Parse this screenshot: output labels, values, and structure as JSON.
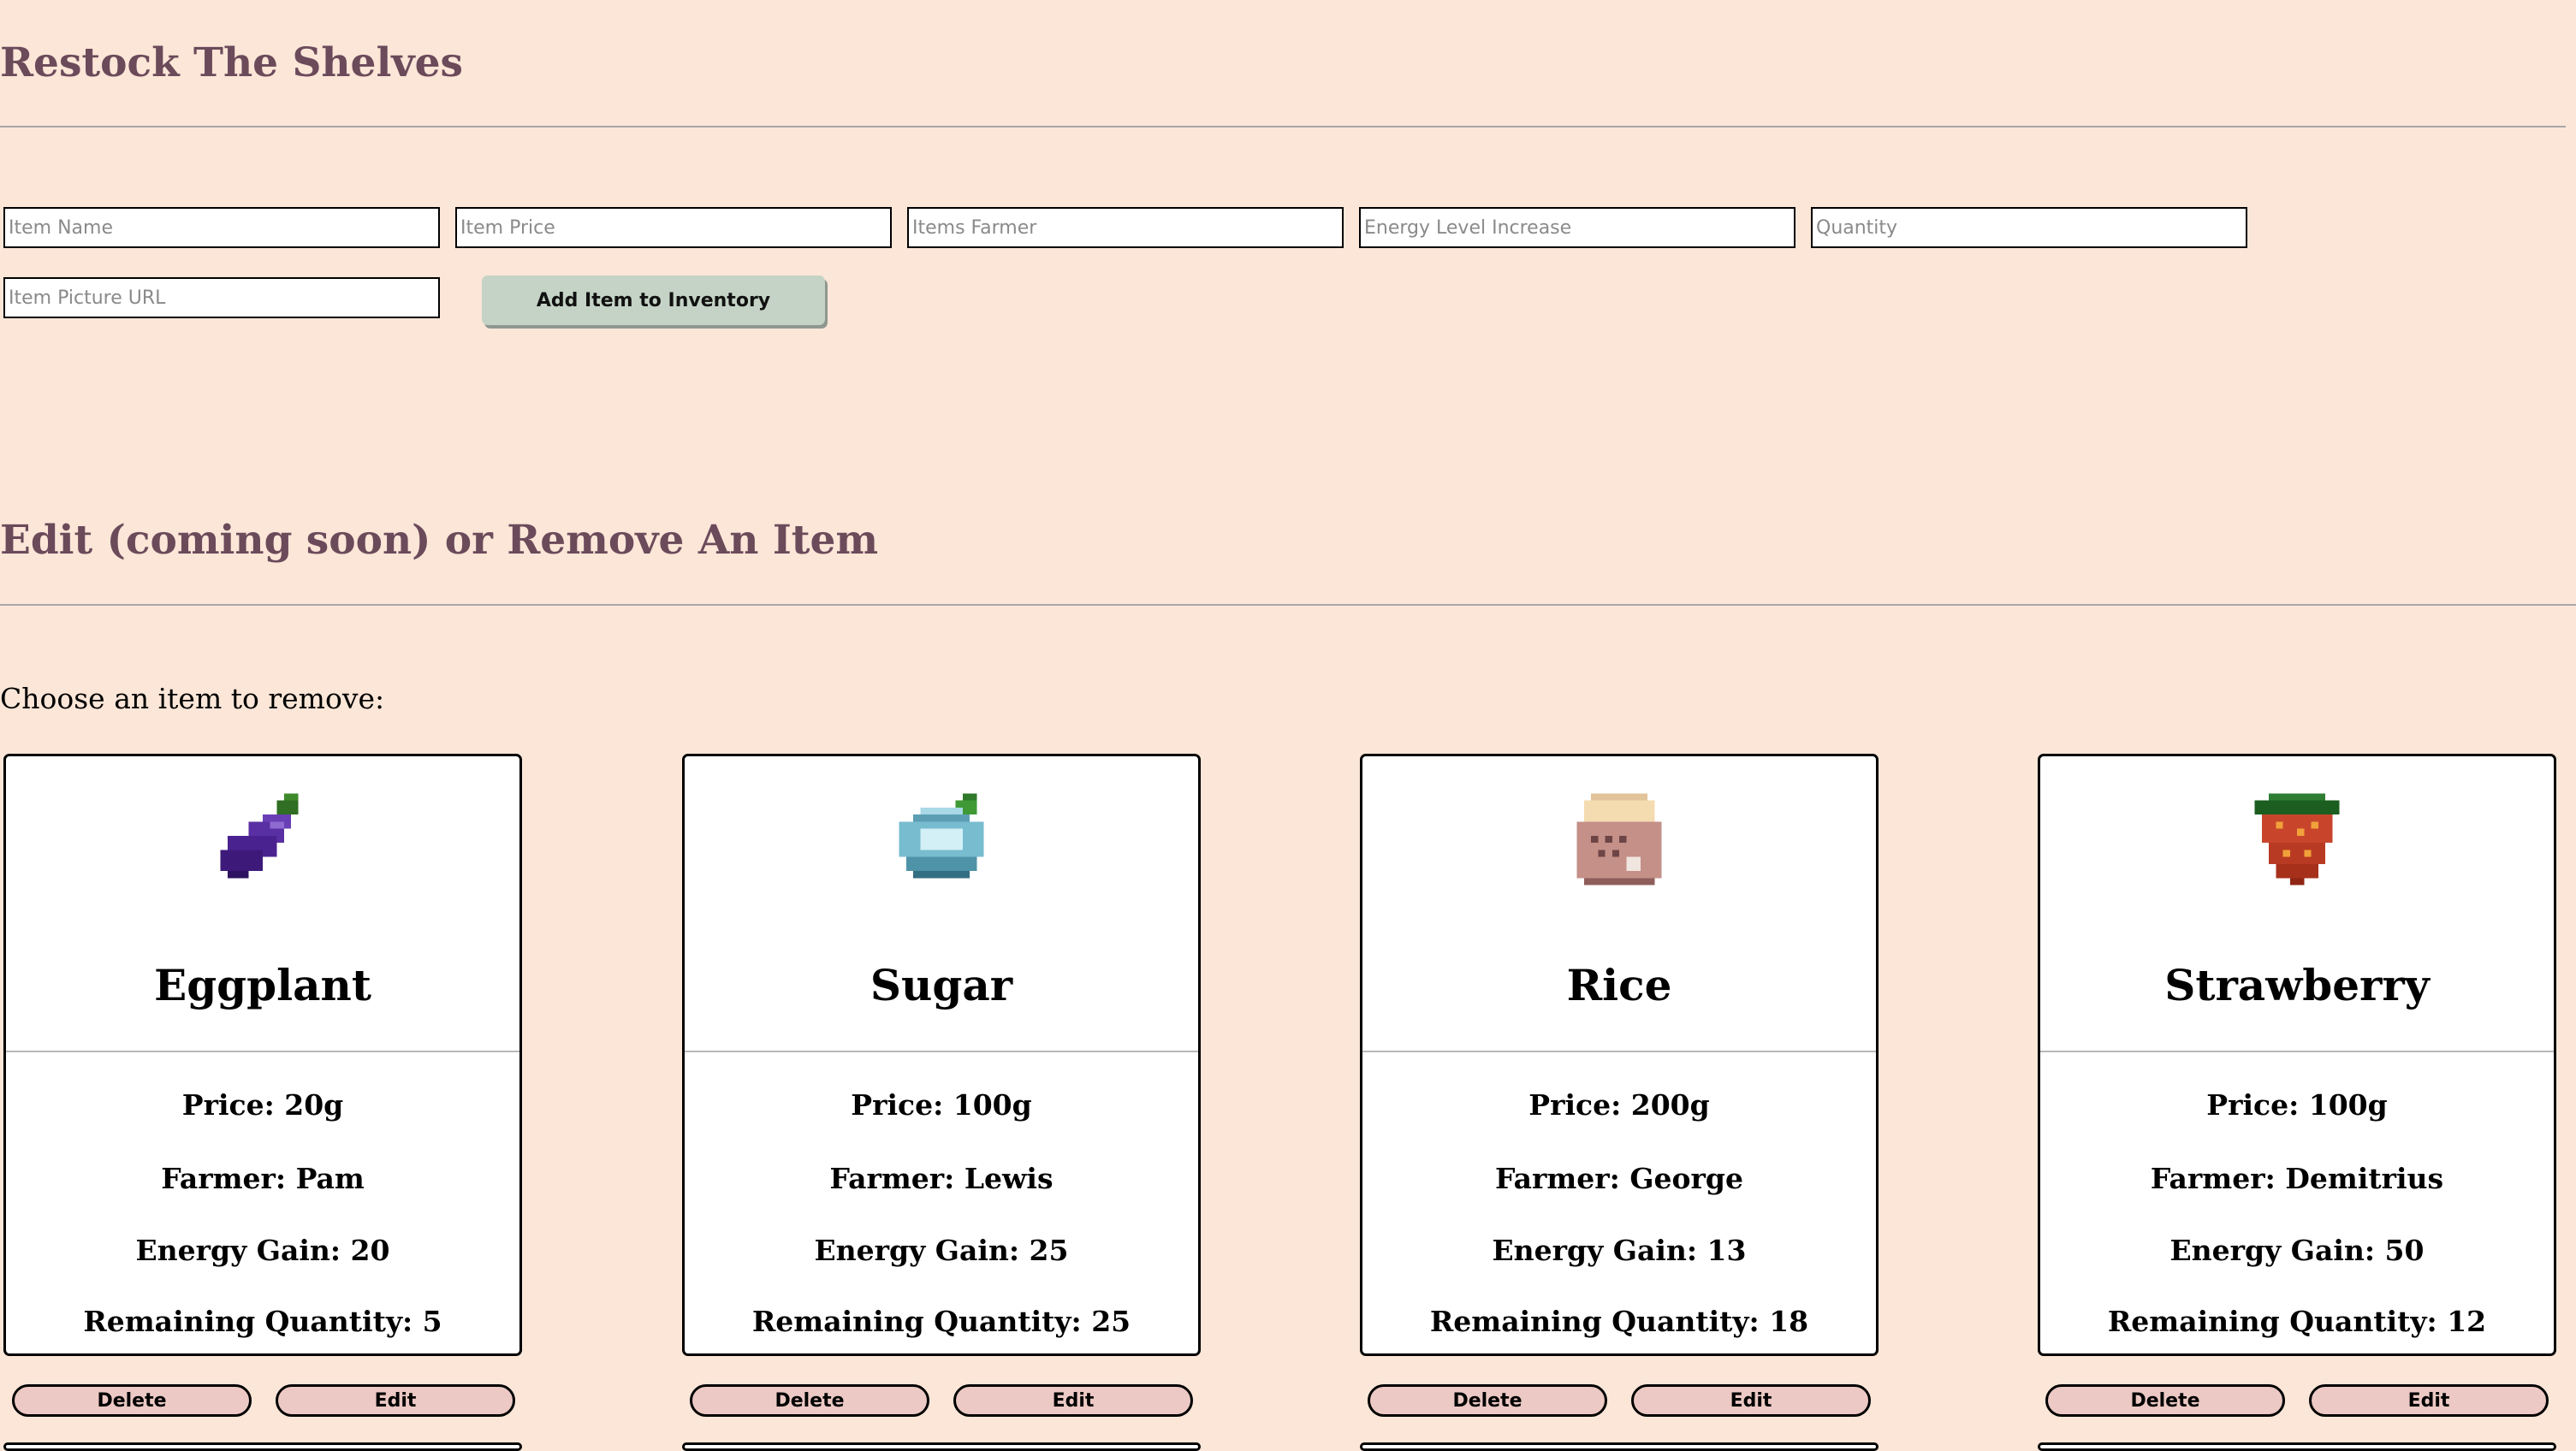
{
  "restock": {
    "title": "Restock The Shelves",
    "fields": {
      "item_name": "Item Name",
      "item_price": "Item Price",
      "items_farmer": "Items Farmer",
      "energy": "Energy Level Increase",
      "quantity": "Quantity",
      "picture_url": "Item Picture URL"
    },
    "add_label": "Add Item to Inventory"
  },
  "edit": {
    "title": "Edit (coming soon) or Remove An Item",
    "prompt": "Choose an item to remove:"
  },
  "items": [
    {
      "name": "Eggplant",
      "price": "Price: 20g",
      "farmer": "Farmer: Pam",
      "energy": "Energy Gain: 20",
      "remaining": "Remaining Quantity: 5",
      "icon": "eggplant-icon"
    },
    {
      "name": "Sugar",
      "price": "Price: 100g",
      "farmer": "Farmer: Lewis",
      "energy": "Energy Gain: 25",
      "remaining": "Remaining Quantity: 25",
      "icon": "sugar-icon"
    },
    {
      "name": "Rice",
      "price": "Price: 200g",
      "farmer": "Farmer: George",
      "energy": "Energy Gain: 13",
      "remaining": "Remaining Quantity: 18",
      "icon": "rice-icon"
    },
    {
      "name": "Strawberry",
      "price": "Price: 100g",
      "farmer": "Farmer: Demitrius",
      "energy": "Energy Gain: 50",
      "remaining": "Remaining Quantity: 12",
      "icon": "strawberry-icon"
    }
  ],
  "buttons": {
    "delete": "Delete",
    "edit": "Edit"
  },
  "colors": {
    "background": "#fbe6d8",
    "heading": "#6b4a5a",
    "add_button": "#c4d3c5",
    "pill_button": "#ecc9c4"
  }
}
